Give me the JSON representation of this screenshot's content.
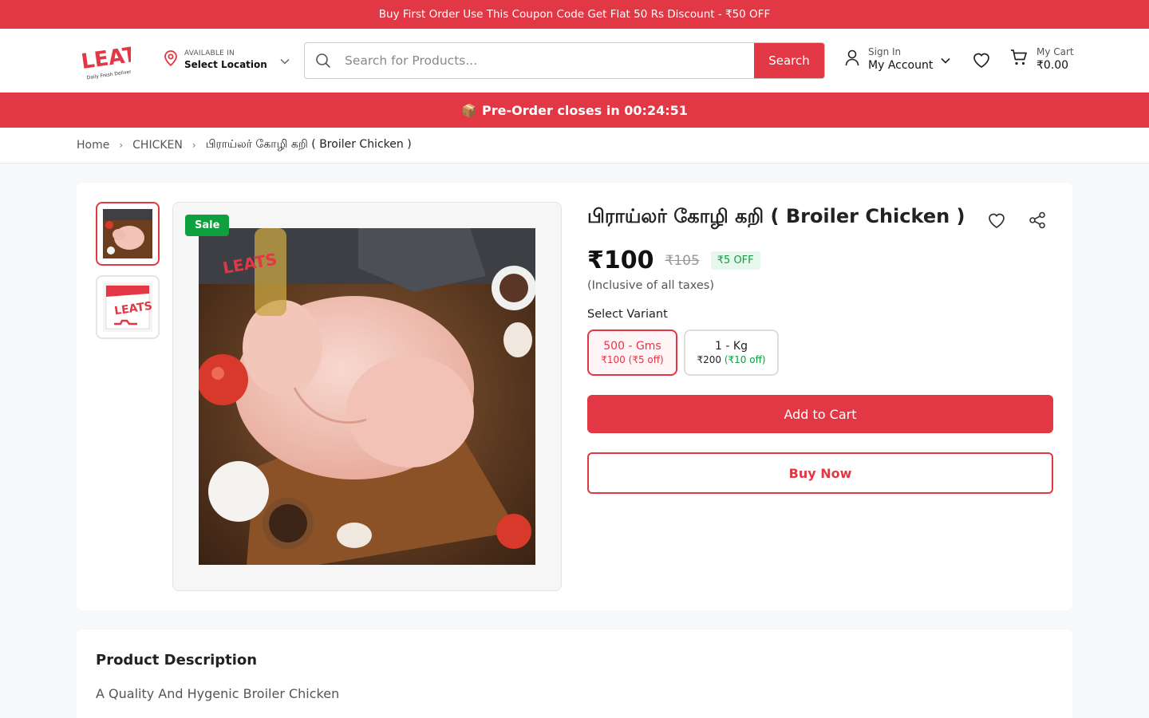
{
  "promo": {
    "text": "Buy First Order Use This Coupon Code Get Flat 50 Rs Discount - ₹50 OFF"
  },
  "header": {
    "logo_text": "LEATS",
    "logo_tagline": "Daily Fresh Delivery",
    "location": {
      "small": "AVAILABLE IN",
      "big": "Select Location"
    },
    "search": {
      "placeholder": "Search for Products...",
      "button": "Search"
    },
    "account": {
      "small": "Sign In",
      "big": "My Account"
    },
    "cart": {
      "small": "My Cart",
      "total": "₹0.00"
    }
  },
  "preorder": {
    "icon": "📦",
    "text": "Pre-Order closes in 00:24:51"
  },
  "breadcrumb": {
    "home": "Home",
    "category": "CHICKEN",
    "current": "பிராய்லர் கோழி கறி ( Broiler Chicken )"
  },
  "product": {
    "sale_badge": "Sale",
    "title": "பிராய்லர் கோழி கறி ( Broiler Chicken )",
    "price": "₹100",
    "mrp": "₹105",
    "off": "₹5 OFF",
    "tax_note": "(Inclusive of all taxes)",
    "variant_label": "Select Variant",
    "variants": [
      {
        "name": "500 - Gms",
        "price": "₹100",
        "save": "(₹5 off)",
        "selected": true
      },
      {
        "name": "1 - Kg",
        "price": "₹200",
        "save": "(₹10 off)",
        "selected": false
      }
    ],
    "add_to_cart": "Add to Cart",
    "buy_now": "Buy Now"
  },
  "description": {
    "title": "Product Description",
    "text": "A Quality And Hygenic Broiler Chicken"
  },
  "colors": {
    "brand": "#e23744",
    "green": "#0e9f3e"
  }
}
